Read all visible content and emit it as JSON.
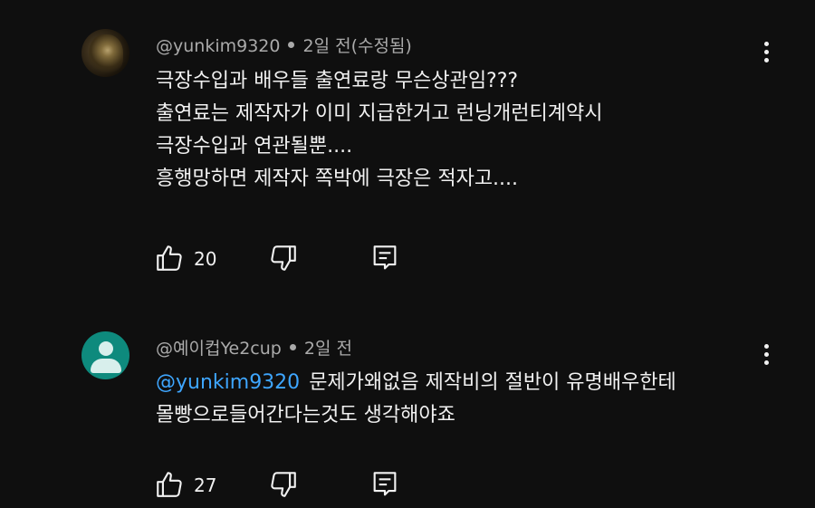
{
  "comments": [
    {
      "author": "@yunkim9320",
      "time": "2일 전(수정됨)",
      "lines": [
        "극장수입과 배우들 출연료랑 무슨상관임???",
        "출연료는 제작자가 이미 지급한거고 런닝개런티계약시",
        "극장수입과 연관될뿐....",
        "흥행망하면 제작자 쪽박에 극장은 적자고...."
      ],
      "likes": "20",
      "avatar": "profile-photo"
    },
    {
      "author": "@예이컵Ye2cup",
      "time": "2일 전",
      "mention": "@yunkim9320",
      "lines": [
        "문제가왜없음 제작비의 절반이 유명배우한테",
        "몰빵으로들어간다는것도 생각해야죠"
      ],
      "likes": "27",
      "avatar": "default-person"
    }
  ],
  "icons": {
    "like": "thumbs-up-icon",
    "dislike": "thumbs-down-icon",
    "reply": "reply-icon",
    "more": "more-vertical-icon"
  },
  "colors": {
    "background": "#0f0f0f",
    "text": "#f1f1f1",
    "secondary": "#aaaaaa",
    "mention": "#3ea6ff",
    "default_avatar": "#0e8a7d"
  }
}
